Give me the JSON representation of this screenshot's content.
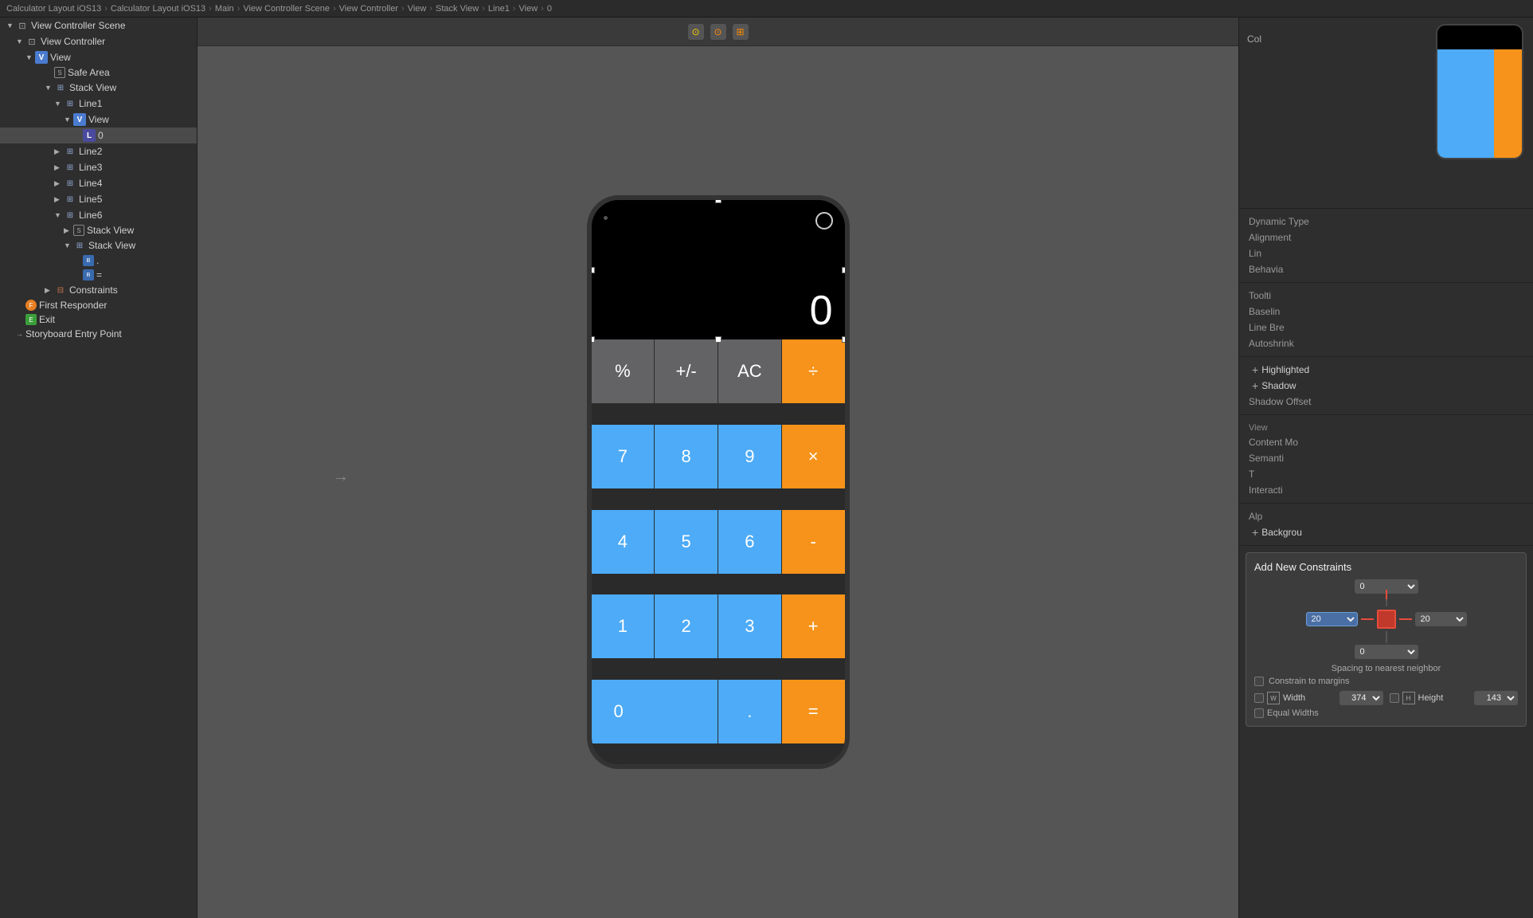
{
  "topbar": {
    "breadcrumbs": [
      "Calculator Layout iOS13",
      "Calculator Layout iOS13",
      "Main",
      "View Controller Scene",
      "View Controller",
      "View",
      "Stack View",
      "Line1",
      "View",
      "0"
    ]
  },
  "sidebar": {
    "title": "View Controller Scene",
    "items": [
      {
        "id": "view-controller-scene",
        "label": "View Controller Scene",
        "indent": 0,
        "arrow": "▼",
        "icon": "scene"
      },
      {
        "id": "view-controller",
        "label": "View Controller",
        "indent": 1,
        "arrow": "▼",
        "icon": "vc"
      },
      {
        "id": "view",
        "label": "View",
        "indent": 2,
        "arrow": "▼",
        "icon": "view"
      },
      {
        "id": "safe-area",
        "label": "Safe Area",
        "indent": 3,
        "arrow": "",
        "icon": "safearea"
      },
      {
        "id": "stack-view",
        "label": "Stack View",
        "indent": 3,
        "arrow": "▼",
        "icon": "stackview"
      },
      {
        "id": "line1",
        "label": "Line1",
        "indent": 4,
        "arrow": "▼",
        "icon": "stackview"
      },
      {
        "id": "line1-view",
        "label": "View",
        "indent": 5,
        "arrow": "▼",
        "icon": "view"
      },
      {
        "id": "line1-view-l0",
        "label": "0",
        "indent": 6,
        "arrow": "",
        "icon": "label",
        "selected": true
      },
      {
        "id": "line2",
        "label": "Line2",
        "indent": 4,
        "arrow": "▶",
        "icon": "stackview"
      },
      {
        "id": "line3",
        "label": "Line3",
        "indent": 4,
        "arrow": "▶",
        "icon": "stackview"
      },
      {
        "id": "line4",
        "label": "Line4",
        "indent": 4,
        "arrow": "▶",
        "icon": "stackview"
      },
      {
        "id": "line5",
        "label": "Line5",
        "indent": 4,
        "arrow": "▶",
        "icon": "stackview"
      },
      {
        "id": "line6",
        "label": "Line6",
        "indent": 4,
        "arrow": "▼",
        "icon": "stackview"
      },
      {
        "id": "line6-stackview1",
        "label": "Stack View",
        "indent": 5,
        "arrow": "▶",
        "icon": "stackview"
      },
      {
        "id": "line6-stackview2",
        "label": "Stack View",
        "indent": 5,
        "arrow": "▼",
        "icon": "stackview"
      },
      {
        "id": "line6-sv2-b1",
        "label": ".",
        "indent": 6,
        "arrow": "",
        "icon": "button"
      },
      {
        "id": "line6-sv2-b2",
        "label": "=",
        "indent": 6,
        "arrow": "",
        "icon": "button"
      },
      {
        "id": "constraints",
        "label": "Constraints",
        "indent": 3,
        "arrow": "▶",
        "icon": "constraint"
      },
      {
        "id": "first-responder",
        "label": "First Responder",
        "indent": 1,
        "arrow": "",
        "icon": "responder"
      },
      {
        "id": "exit",
        "label": "Exit",
        "indent": 1,
        "arrow": "",
        "icon": "exit"
      },
      {
        "id": "storyboard-entry",
        "label": "Storyboard Entry Point",
        "indent": 1,
        "arrow": "→",
        "icon": "entry"
      }
    ]
  },
  "canvas": {
    "toolbar_buttons": [
      "pin",
      "zoom",
      "layout"
    ],
    "phone": {
      "display_text": "",
      "camera_icon": "○",
      "buttons": [
        {
          "label": "%",
          "style": "gray"
        },
        {
          "label": "+/-",
          "style": "gray"
        },
        {
          "label": "AC",
          "style": "gray"
        },
        {
          "label": "÷",
          "style": "orange"
        },
        {
          "label": "7",
          "style": "blue"
        },
        {
          "label": "8",
          "style": "blue"
        },
        {
          "label": "9",
          "style": "blue"
        },
        {
          "label": "×",
          "style": "orange"
        },
        {
          "label": "4",
          "style": "blue"
        },
        {
          "label": "5",
          "style": "blue"
        },
        {
          "label": "6",
          "style": "blue"
        },
        {
          "label": "-",
          "style": "orange"
        },
        {
          "label": "1",
          "style": "blue"
        },
        {
          "label": "2",
          "style": "blue"
        },
        {
          "label": "3",
          "style": "blue"
        },
        {
          "label": "+",
          "style": "orange"
        },
        {
          "label": "0",
          "style": "blue",
          "double": true
        },
        {
          "label": ".",
          "style": "blue"
        },
        {
          "label": "=",
          "style": "orange"
        }
      ]
    }
  },
  "right_panel": {
    "section_col": "Col",
    "attributes": [
      {
        "label": "Dynamic Type",
        "value": ""
      },
      {
        "label": "Alignment",
        "value": ""
      },
      {
        "label": "Lin",
        "value": ""
      },
      {
        "label": "Behavia",
        "value": ""
      },
      {
        "label": "Toolti",
        "value": ""
      },
      {
        "label": "Baselin",
        "value": ""
      },
      {
        "label": "Line Bre",
        "value": ""
      },
      {
        "label": "Autoshrink",
        "value": ""
      }
    ],
    "plus_sections": [
      "Highlighted",
      "Shadow",
      "Shadow Offset"
    ],
    "view_section": {
      "title": "View",
      "rows": [
        {
          "label": "Content Mo",
          "value": ""
        },
        {
          "label": "Semanti",
          "value": ""
        },
        {
          "label": "T",
          "value": ""
        },
        {
          "label": "Interacti",
          "value": ""
        }
      ]
    },
    "alpha_bg": [
      "Alp",
      "Backgrou"
    ],
    "constraints": {
      "title": "Add New Constraints",
      "top_value": "0",
      "left_value": "20",
      "right_value": "20",
      "bottom_value": "0",
      "spacing_label": "Spacing to nearest neighbor",
      "constrain_margins": "Constrain to margins",
      "width_label": "Width",
      "width_value": "374",
      "height_label": "Height",
      "height_value": "143",
      "equal_widths": "Equal Widths"
    }
  }
}
